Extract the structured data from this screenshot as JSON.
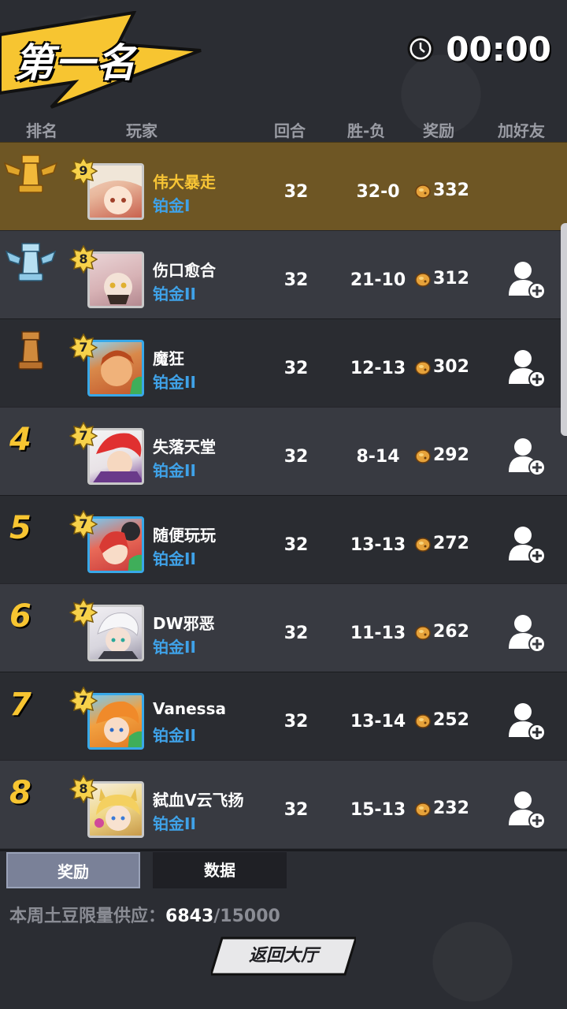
{
  "header": {
    "title": "第一名",
    "timer": "00:00"
  },
  "columns": {
    "rank": "排名",
    "player": "玩家",
    "rounds": "回合",
    "record": "胜-负",
    "reward": "奖励",
    "add_friend": "加好友"
  },
  "rows": [
    {
      "rank": "1",
      "level": "9",
      "name": "伟大暴走",
      "tier": "铂金I",
      "rounds": "32",
      "record": "32-0",
      "reward": "332"
    },
    {
      "rank": "2",
      "level": "8",
      "name": "伤口愈合",
      "tier": "铂金II",
      "rounds": "32",
      "record": "21-10",
      "reward": "312"
    },
    {
      "rank": "3",
      "level": "7",
      "name": "魔狂",
      "tier": "铂金II",
      "rounds": "32",
      "record": "12-13",
      "reward": "302"
    },
    {
      "rank": "4",
      "level": "7",
      "name": "失落天堂",
      "tier": "铂金II",
      "rounds": "32",
      "record": "8-14",
      "reward": "292"
    },
    {
      "rank": "5",
      "level": "7",
      "name": "随便玩玩",
      "tier": "铂金II",
      "rounds": "32",
      "record": "13-13",
      "reward": "272"
    },
    {
      "rank": "6",
      "level": "7",
      "name": "DW邪恶",
      "tier": "铂金II",
      "rounds": "32",
      "record": "11-13",
      "reward": "262"
    },
    {
      "rank": "7",
      "level": "7",
      "name": "Vanessa",
      "tier": "铂金II",
      "rounds": "32",
      "record": "13-14",
      "reward": "252"
    },
    {
      "rank": "8",
      "level": "8",
      "name": "弑血V云飞扬",
      "tier": "铂金II",
      "rounds": "32",
      "record": "15-13",
      "reward": "232"
    }
  ],
  "tabs": {
    "reward": "奖励",
    "data": "数据"
  },
  "supply": {
    "label": "本周土豆限量供应：",
    "current": "6843",
    "max": "/15000"
  },
  "back_button": "返回大厅",
  "icons": {
    "timer": "clock-icon",
    "reward": "potato-coin-icon",
    "add_friend": "add-friend-icon",
    "rank1": "gold-rook-trophy-icon",
    "rank2": "silver-rook-trophy-icon",
    "rank3": "bronze-rook-icon"
  },
  "colors": {
    "accent_yellow": "#f7c531",
    "tier_blue": "#3fa2e8",
    "first_row": "#6e5624"
  }
}
